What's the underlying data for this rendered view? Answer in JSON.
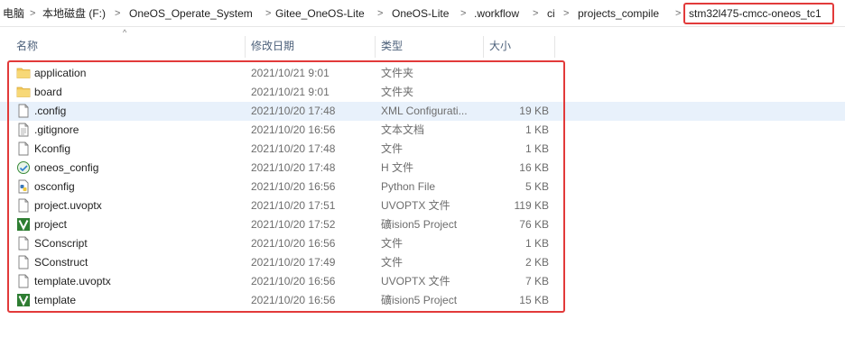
{
  "breadcrumb": {
    "items": [
      "电脑",
      "本地磁盘 (F:)",
      "OneOS_Operate_System",
      "Gitee_OneOS-Lite",
      "OneOS-Lite",
      ".workflow",
      "ci",
      "projects_compile",
      "stm32l475-cmcc-oneos_tc1"
    ],
    "separator": ">"
  },
  "columns": {
    "name": "名称",
    "date": "修改日期",
    "type": "类型",
    "size": "大小"
  },
  "files": [
    {
      "name": "application",
      "date": "2021/10/21 9:01",
      "type": "文件夹",
      "size": "",
      "icon": "folder-icon"
    },
    {
      "name": "board",
      "date": "2021/10/21 9:01",
      "type": "文件夹",
      "size": "",
      "icon": "folder-icon"
    },
    {
      "name": ".config",
      "date": "2021/10/20 17:48",
      "type": "XML Configurati...",
      "size": "19 KB",
      "icon": "file-icon",
      "selected": true
    },
    {
      "name": ".gitignore",
      "date": "2021/10/20 16:56",
      "type": "文本文档",
      "size": "1 KB",
      "icon": "text-file-icon"
    },
    {
      "name": "Kconfig",
      "date": "2021/10/20 17:48",
      "type": "文件",
      "size": "1 KB",
      "icon": "file-icon"
    },
    {
      "name": "oneos_config",
      "date": "2021/10/20 17:48",
      "type": "H 文件",
      "size": "16 KB",
      "icon": "header-file-icon"
    },
    {
      "name": "osconfig",
      "date": "2021/10/20 16:56",
      "type": "Python File",
      "size": "5 KB",
      "icon": "python-file-icon"
    },
    {
      "name": "project.uvoptx",
      "date": "2021/10/20 17:51",
      "type": "UVOPTX 文件",
      "size": "119 KB",
      "icon": "file-icon"
    },
    {
      "name": "project",
      "date": "2021/10/20 17:52",
      "type": "礦ision5 Project",
      "size": "76 KB",
      "icon": "keil-project-icon"
    },
    {
      "name": "SConscript",
      "date": "2021/10/20 16:56",
      "type": "文件",
      "size": "1 KB",
      "icon": "file-icon"
    },
    {
      "name": "SConstruct",
      "date": "2021/10/20 17:49",
      "type": "文件",
      "size": "2 KB",
      "icon": "file-icon"
    },
    {
      "name": "template.uvoptx",
      "date": "2021/10/20 16:56",
      "type": "UVOPTX 文件",
      "size": "7 KB",
      "icon": "file-icon"
    },
    {
      "name": "template",
      "date": "2021/10/20 16:56",
      "type": "礦ision5 Project",
      "size": "15 KB",
      "icon": "keil-project-icon"
    }
  ],
  "colors": {
    "highlight": "#e23a3a",
    "selected_row": "#e8f1fb",
    "folder": "#f3c958",
    "header_text": "#4c607a"
  }
}
